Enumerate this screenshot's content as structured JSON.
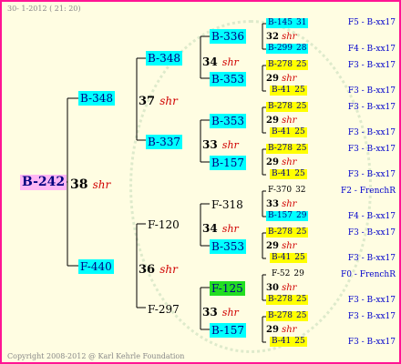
{
  "header": "30-  1-2012 ( 21: 20)",
  "footer": "Copyright 2008-2012 @ Karl Kehrle Foundation",
  "root": {
    "code": "B-242",
    "gen": "38",
    "shr": "shr"
  },
  "gen1": [
    {
      "code": "B-348",
      "gen": "37",
      "shr": "shr"
    },
    {
      "code": "F-440",
      "gen": "36",
      "shr": "shr"
    }
  ],
  "gen2": [
    {
      "code": "B-348",
      "gen": "34",
      "shr": "shr"
    },
    {
      "code": "B-337",
      "gen": "33",
      "shr": "shr"
    },
    {
      "code": "F-120",
      "gen": "34",
      "shr": "shr"
    },
    {
      "code": "F-297",
      "gen": "33",
      "shr": "shr"
    }
  ],
  "gen3": [
    {
      "code": "B-336",
      "gen": "32",
      "shr": "shr"
    },
    {
      "code": "B-353",
      "gen": "29",
      "shr": "shr"
    },
    {
      "code": "B-353",
      "gen": "29",
      "shr": "shr"
    },
    {
      "code": "B-157",
      "gen": "29",
      "shr": "shr"
    },
    {
      "code": "F-318",
      "gen": "33",
      "shr": "shr"
    },
    {
      "code": "B-353",
      "gen": "29",
      "shr": "shr"
    },
    {
      "code": "F-125",
      "gen": "30",
      "shr": "shr"
    },
    {
      "code": "B-157",
      "gen": "29",
      "shr": "shr"
    }
  ],
  "gen4": [
    {
      "code": "B-145",
      "num": "31",
      "right": "F5 - B-xx17"
    },
    {
      "code": "B-299",
      "num": "28",
      "right": "F4 - B-xx17"
    },
    {
      "code": "B-278",
      "num": "25",
      "right": "F3 - B-xx17"
    },
    {
      "code": "B-41",
      "num": "25",
      "right": "F3 - B-xx17"
    },
    {
      "code": "B-278",
      "num": "25",
      "right": "F3 - B-xx17"
    },
    {
      "code": "B-41",
      "num": "25",
      "right": "F3 - B-xx17"
    },
    {
      "code": "B-278",
      "num": "25",
      "right": "F3 - B-xx17"
    },
    {
      "code": "B-41",
      "num": "25",
      "right": "F3 - B-xx17"
    },
    {
      "code": "F-370",
      "num": "32",
      "right": "F2 - FrenchR"
    },
    {
      "code": "B-157",
      "num": "29",
      "right": "F4 - B-xx17"
    },
    {
      "code": "B-278",
      "num": "25",
      "right": "F3 - B-xx17"
    },
    {
      "code": "B-41",
      "num": "25",
      "right": "F3 - B-xx17"
    },
    {
      "code": "F-52",
      "num": "29",
      "right": "F0 - FrenchR"
    },
    {
      "code": "B-278",
      "num": "25",
      "right": "F3 - B-xx17"
    },
    {
      "code": "B-278",
      "num": "25",
      "right": "F3 - B-xx17"
    },
    {
      "code": "B-41",
      "num": "25",
      "right": "F3 - B-xx17"
    }
  ]
}
